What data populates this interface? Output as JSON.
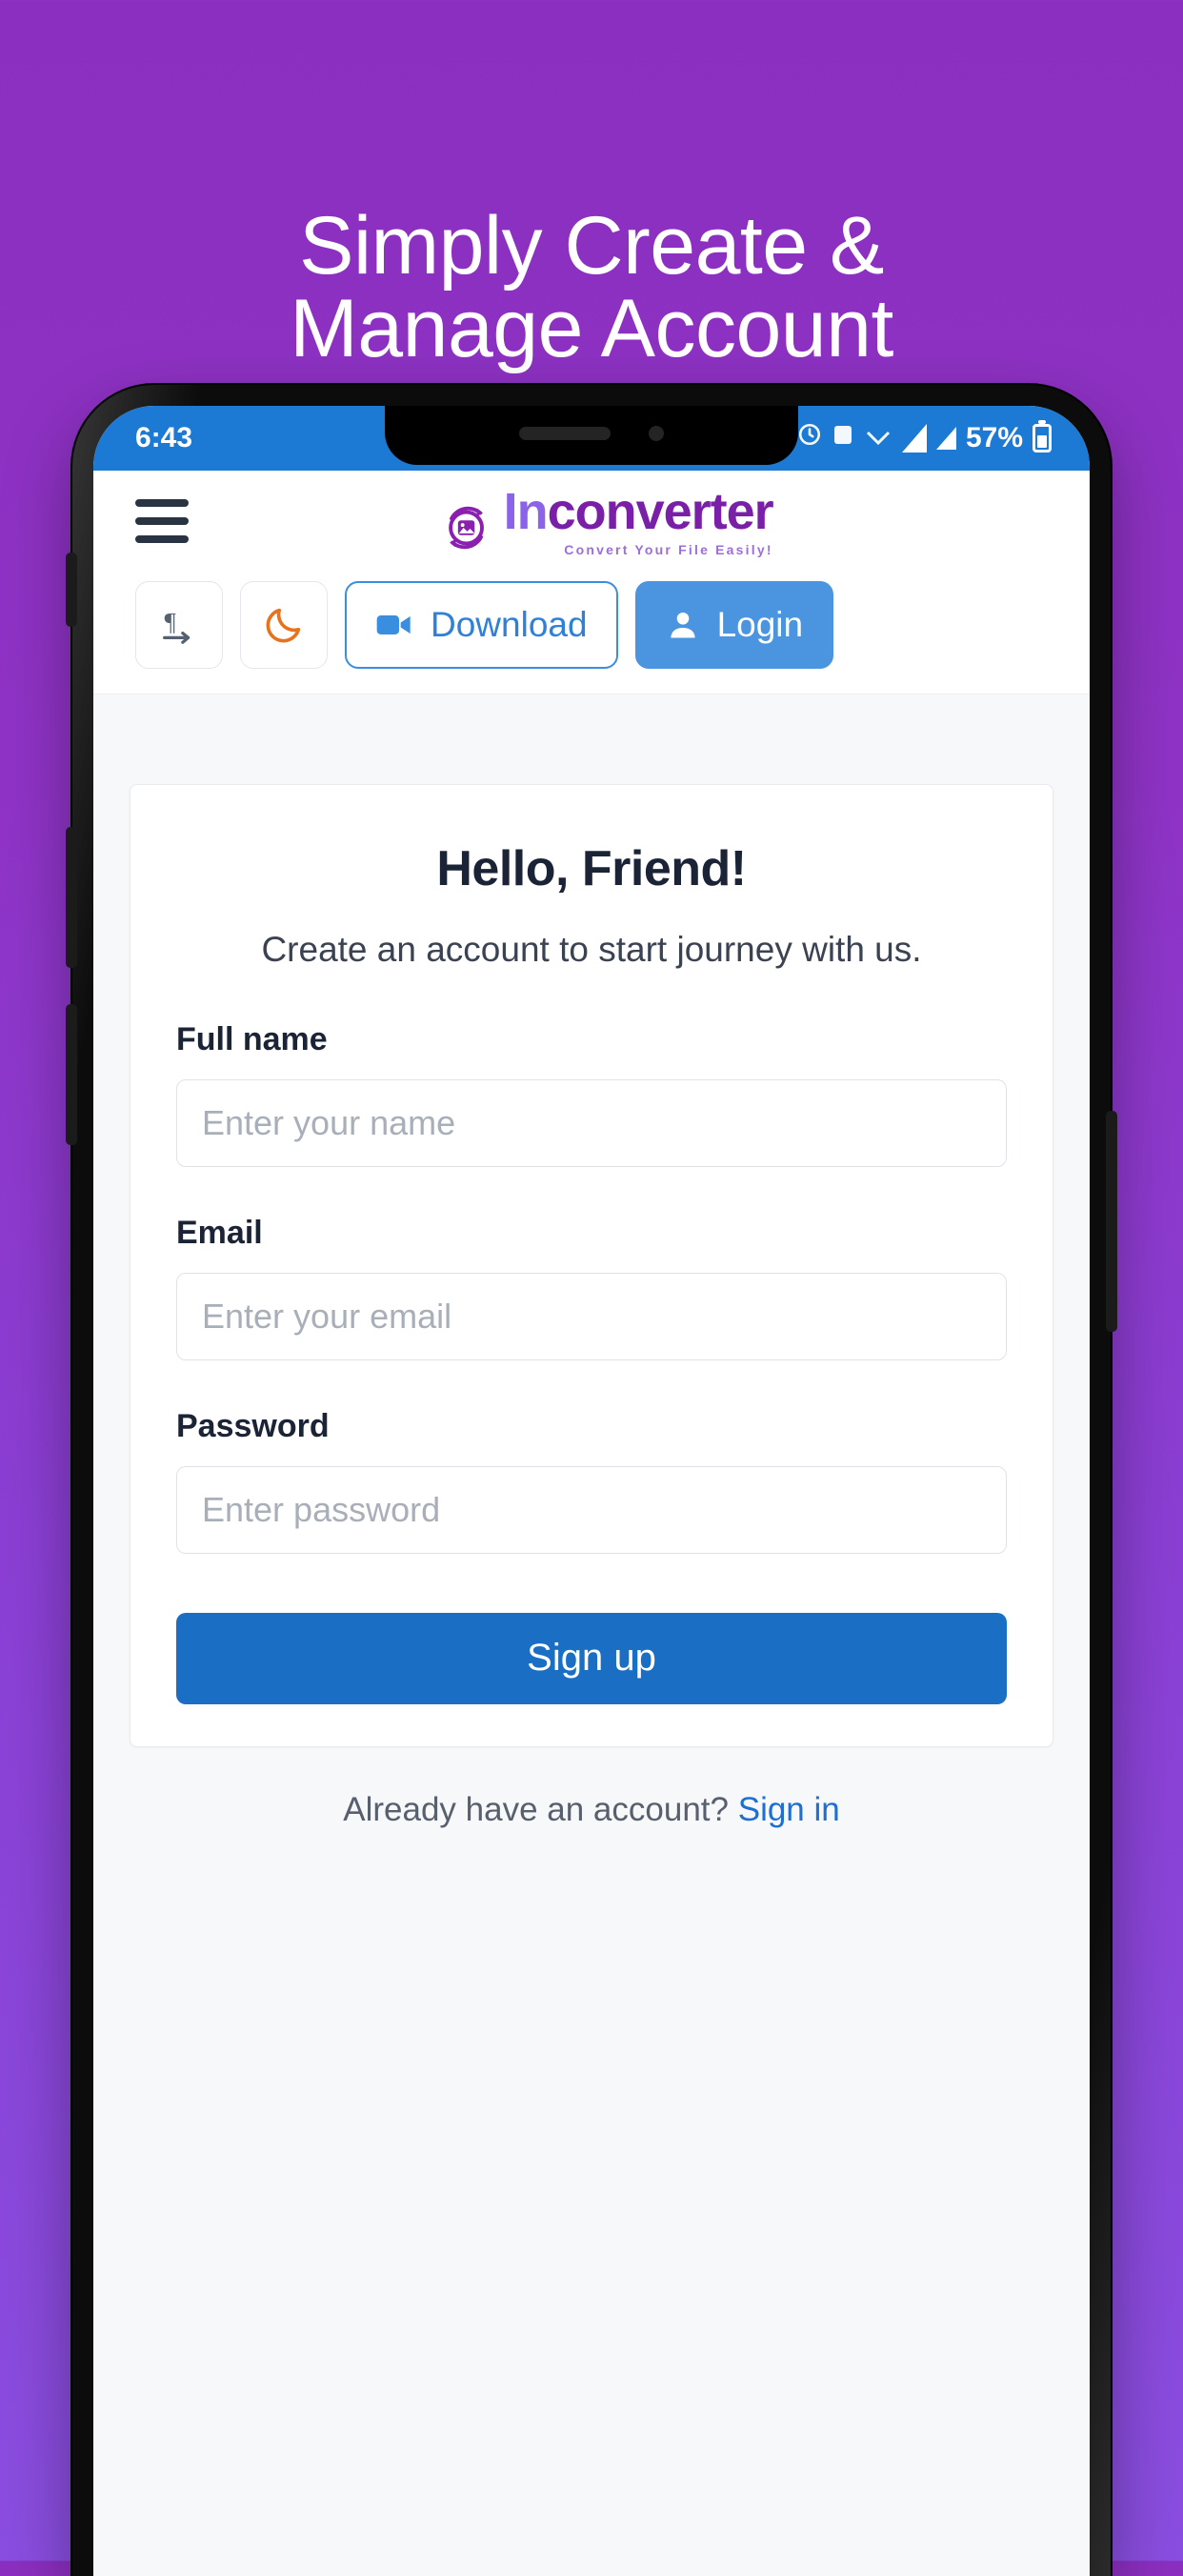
{
  "hero": {
    "title": "Simply Create &\nManage Account"
  },
  "phone": {
    "statusbar": {
      "time": "6:43",
      "battery_percent": "57%",
      "icons": [
        "clock-icon",
        "sim-card-icon",
        "wifi-icon",
        "signal-icon",
        "signal-icon",
        "battery-icon"
      ]
    },
    "appbar": {
      "menu_icon": "hamburger-menu-icon",
      "logo_mark": "image-convert-icon",
      "logo_text_part1": "In",
      "logo_text_part2": "converter",
      "logo_tagline": "Convert Your File Easily!"
    },
    "toolbar": {
      "translate_icon": "translate-icon",
      "darkmode_icon": "moon-icon",
      "download_icon": "video-camera-icon",
      "download_label": "Download",
      "login_icon": "user-icon",
      "login_label": "Login"
    },
    "signup_card": {
      "title": "Hello, Friend!",
      "subtitle": "Create an account to start journey with us.",
      "fields": [
        {
          "label": "Full name",
          "placeholder": "Enter your name",
          "value": ""
        },
        {
          "label": "Email",
          "placeholder": "Enter your email",
          "value": ""
        },
        {
          "label": "Password",
          "placeholder": "Enter password",
          "value": ""
        }
      ],
      "submit_label": "Sign up",
      "footer_text": "Already have an account?",
      "footer_link": "Sign in"
    }
  },
  "colors": {
    "background_purple": "#8b33c4",
    "statusbar_blue": "#1d7ad4",
    "primary_blue": "#1a6fc4",
    "accent_blue": "#4a94e0",
    "link_blue": "#1f6fd0",
    "logo_purple": "#7a1fa8",
    "logo_violet": "#8b63e8",
    "moon_orange": "#e8731f"
  }
}
